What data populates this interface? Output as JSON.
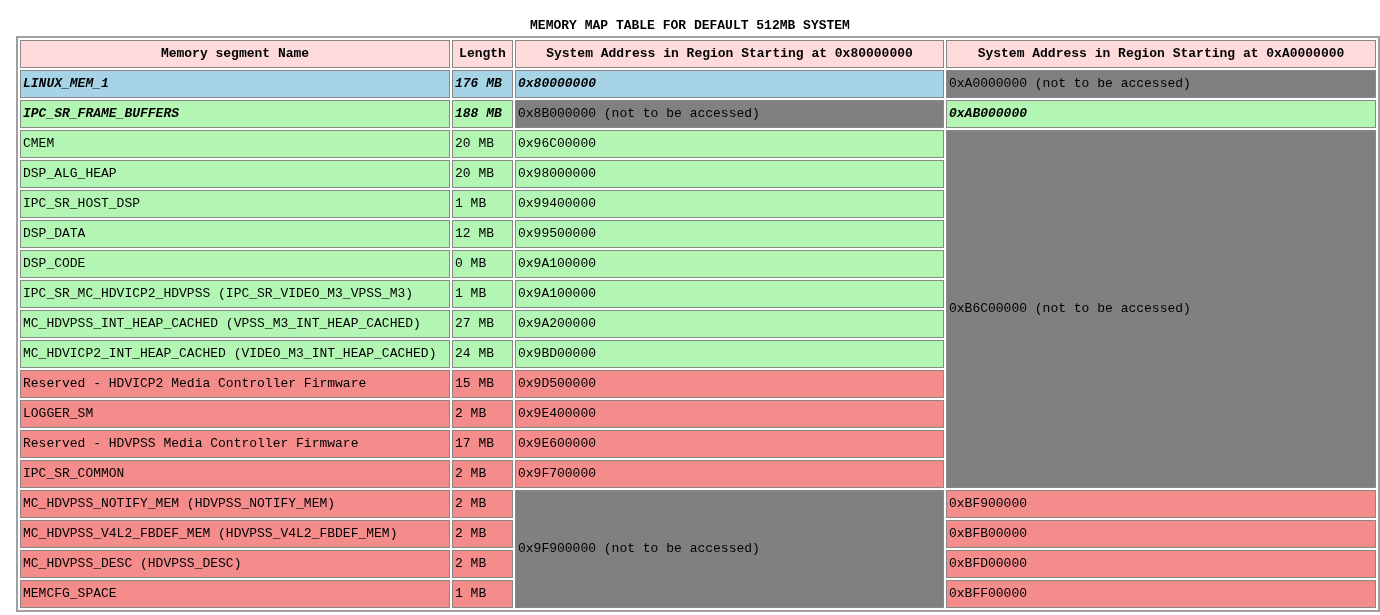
{
  "title": "MEMORY MAP TABLE FOR DEFAULT 512MB SYSTEM",
  "columns": [
    "Memory segment Name",
    "Length",
    "System Address in Region Starting at 0x80000000",
    "System Address in Region Starting at 0xA0000000"
  ],
  "rows": [
    {
      "name": "LINUX_MEM_1",
      "length": "176 MB",
      "color": "#a6d4e6",
      "emphasized": true,
      "addr_80": {
        "text": "0x80000000",
        "kind": "address"
      },
      "addr_a0": {
        "text": "0xA0000000 (not to be accessed)",
        "kind": "blocked"
      }
    },
    {
      "name": "IPC_SR_FRAME_BUFFERS",
      "length": "188 MB",
      "color": "#b3f5b3",
      "emphasized": true,
      "addr_80": {
        "text": "0x8B000000 (not to be accessed)",
        "kind": "blocked"
      },
      "addr_a0": {
        "text": "0xAB000000",
        "kind": "address"
      }
    },
    {
      "name": "CMEM",
      "length": "20 MB",
      "color": "#b3f5b3",
      "emphasized": false,
      "addr_80": {
        "text": "0x96C00000",
        "kind": "address"
      },
      "addr_a0": {
        "text": "0xB6C00000 (not to be accessed)",
        "kind": "blocked"
      }
    },
    {
      "name": "DSP_ALG_HEAP",
      "length": "20 MB",
      "color": "#b3f5b3",
      "emphasized": false,
      "addr_80": {
        "text": "0x98000000",
        "kind": "address"
      }
    },
    {
      "name": "IPC_SR_HOST_DSP",
      "length": "1 MB",
      "color": "#b3f5b3",
      "emphasized": false,
      "addr_80": {
        "text": "0x99400000",
        "kind": "address"
      }
    },
    {
      "name": "DSP_DATA",
      "length": "12 MB",
      "color": "#b3f5b3",
      "emphasized": false,
      "addr_80": {
        "text": "0x99500000",
        "kind": "address"
      }
    },
    {
      "name": "DSP_CODE",
      "length": "0 MB",
      "color": "#b3f5b3",
      "emphasized": false,
      "addr_80": {
        "text": "0x9A100000",
        "kind": "address"
      }
    },
    {
      "name": "IPC_SR_MC_HDVICP2_HDVPSS (IPC_SR_VIDEO_M3_VPSS_M3)",
      "length": "1 MB",
      "color": "#b3f5b3",
      "emphasized": false,
      "addr_80": {
        "text": "0x9A100000",
        "kind": "address"
      }
    },
    {
      "name": "MC_HDVPSS_INT_HEAP_CACHED (VPSS_M3_INT_HEAP_CACHED)",
      "length": "27 MB",
      "color": "#b3f5b3",
      "emphasized": false,
      "addr_80": {
        "text": "0x9A200000",
        "kind": "address"
      }
    },
    {
      "name": "MC_HDVICP2_INT_HEAP_CACHED (VIDEO_M3_INT_HEAP_CACHED)",
      "length": "24 MB",
      "color": "#b3f5b3",
      "emphasized": false,
      "addr_80": {
        "text": "0x9BD00000",
        "kind": "address"
      }
    },
    {
      "name": "Reserved - HDVICP2 Media Controller Firmware",
      "length": "15 MB",
      "color": "#f48c8c",
      "emphasized": false,
      "addr_80": {
        "text": "0x9D500000",
        "kind": "address"
      }
    },
    {
      "name": "LOGGER_SM",
      "length": "2 MB",
      "color": "#f48c8c",
      "emphasized": false,
      "addr_80": {
        "text": "0x9E400000",
        "kind": "address"
      }
    },
    {
      "name": "Reserved - HDVPSS Media Controller Firmware",
      "length": "17 MB",
      "color": "#f48c8c",
      "emphasized": false,
      "addr_80": {
        "text": "0x9E600000",
        "kind": "address"
      }
    },
    {
      "name": "IPC_SR_COMMON",
      "length": "2 MB",
      "color": "#f48c8c",
      "emphasized": false,
      "addr_80": {
        "text": "0x9F700000",
        "kind": "address"
      }
    },
    {
      "name": "MC_HDVPSS_NOTIFY_MEM (HDVPSS_NOTIFY_MEM)",
      "length": "2 MB",
      "color": "#f48c8c",
      "emphasized": false,
      "addr_80": {
        "text": "0x9F900000 (not to be accessed)",
        "kind": "blocked"
      },
      "addr_a0": {
        "text": "0xBF900000",
        "kind": "address"
      }
    },
    {
      "name": "MC_HDVPSS_V4L2_FBDEF_MEM (HDVPSS_V4L2_FBDEF_MEM)",
      "length": "2 MB",
      "color": "#f48c8c",
      "emphasized": false,
      "addr_a0": {
        "text": "0xBFB00000",
        "kind": "address"
      }
    },
    {
      "name": "MC_HDVPSS_DESC (HDVPSS_DESC)",
      "length": "2 MB",
      "color": "#f48c8c",
      "emphasized": false,
      "addr_a0": {
        "text": "0xBFD00000",
        "kind": "address"
      }
    },
    {
      "name": "MEMCFG_SPACE",
      "length": "1 MB",
      "color": "#f48c8c",
      "emphasized": false,
      "addr_a0": {
        "text": "0xBFF00000",
        "kind": "address"
      }
    }
  ]
}
